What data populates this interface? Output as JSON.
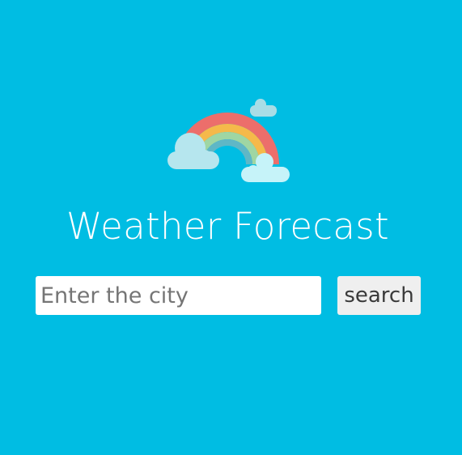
{
  "app": {
    "title": "Weather Forecast",
    "logo_icon": "rainbow-with-clouds-icon"
  },
  "search": {
    "placeholder": "Enter the city",
    "value": "",
    "button_label": "search"
  },
  "colors": {
    "background": "#00bde3",
    "title_text": "#ffffff",
    "input_background": "#ffffff",
    "button_background": "#efefef",
    "rainbow_red": "#ec6e6b",
    "rainbow_orange": "#f5b94a",
    "rainbow_green": "#9fd6a3",
    "rainbow_teal": "#5fb7c6",
    "cloud": "#b6e6ee"
  }
}
